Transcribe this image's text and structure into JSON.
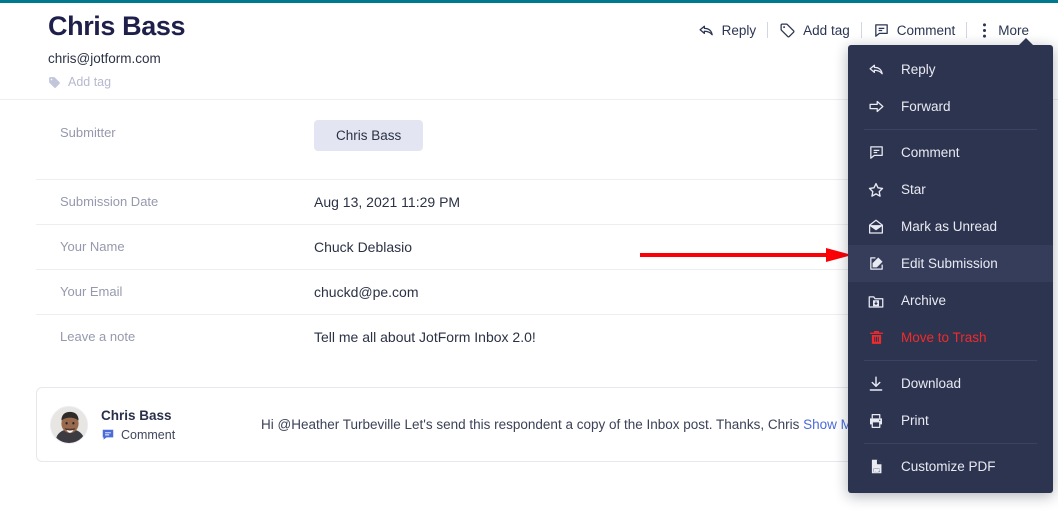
{
  "theme": {
    "top_bar_color": "#00798f",
    "menu_bg": "#2d3450",
    "menu_active_bg": "#363d5b",
    "danger_color": "#f02b2b",
    "link_color": "#4a6bd8",
    "chip_bg": "#e3e6f2",
    "annotation_color": "#fb0007"
  },
  "header": {
    "title": "Chris Bass",
    "email": "chris@jotform.com",
    "add_tag_label": "Add tag",
    "add_tag_icon": "tag-icon"
  },
  "toolbar": {
    "items": [
      {
        "label": "Reply",
        "icon": "reply-arrow-icon"
      },
      {
        "label": "Add tag",
        "icon": "tag-icon"
      },
      {
        "label": "Comment",
        "icon": "comment-bubble-icon"
      },
      {
        "label": "More",
        "icon": "vertical-dots-icon"
      }
    ]
  },
  "fields": [
    {
      "label": "Submitter",
      "value": "Chris Bass",
      "type": "chip"
    },
    {
      "label": "Submission Date",
      "value": "Aug 13, 2021 11:29 PM",
      "type": "text"
    },
    {
      "label": "Your Name",
      "value": "Chuck Deblasio",
      "type": "text"
    },
    {
      "label": "Your Email",
      "value": "chuckd@pe.com",
      "type": "text"
    },
    {
      "label": "Leave a note",
      "value": "Tell me all about JotForm Inbox 2.0!",
      "type": "text"
    }
  ],
  "comment": {
    "author": "Chris Bass",
    "kind_label": "Comment",
    "kind_icon": "comment-bubble-icon",
    "avatar_icon": "user-photo-avatar",
    "text": "Hi @Heather Turbeville Let's send this respondent a copy of the Inbox post. Thanks, Chris",
    "show_more_label": "Show More"
  },
  "dropdown": {
    "items": [
      {
        "label": "Reply",
        "icon": "reply-arrow-icon",
        "kind": "normal",
        "sep_after": false
      },
      {
        "label": "Forward",
        "icon": "forward-arrow-icon",
        "kind": "normal",
        "sep_after": true
      },
      {
        "label": "Comment",
        "icon": "comment-bubble-icon",
        "kind": "normal",
        "sep_after": false
      },
      {
        "label": "Star",
        "icon": "star-icon",
        "kind": "normal",
        "sep_after": false
      },
      {
        "label": "Mark as Unread",
        "icon": "envelope-icon",
        "kind": "normal",
        "sep_after": false
      },
      {
        "label": "Edit Submission",
        "icon": "edit-pencil-icon",
        "kind": "active",
        "sep_after": false
      },
      {
        "label": "Archive",
        "icon": "archive-folder-icon",
        "kind": "normal",
        "sep_after": false
      },
      {
        "label": "Move to Trash",
        "icon": "trash-icon",
        "kind": "danger",
        "sep_after": true
      },
      {
        "label": "Download",
        "icon": "download-icon",
        "kind": "normal",
        "sep_after": false
      },
      {
        "label": "Print",
        "icon": "printer-icon",
        "kind": "normal",
        "sep_after": true
      },
      {
        "label": "Customize PDF",
        "icon": "pdf-file-icon",
        "kind": "normal",
        "sep_after": false
      }
    ]
  },
  "annotation": {
    "type": "red-arrow-right",
    "points_to": "Edit Submission"
  }
}
